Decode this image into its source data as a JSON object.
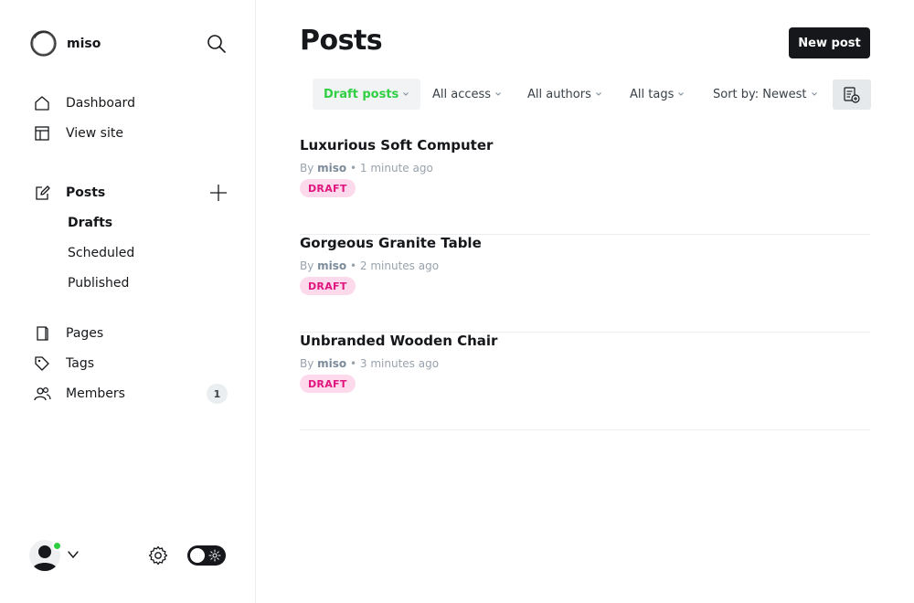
{
  "brand": {
    "name": "miso",
    "logo_icon": "circle-logo-icon"
  },
  "nav": {
    "dashboard": "Dashboard",
    "view_site": "View site",
    "posts": "Posts",
    "drafts": "Drafts",
    "scheduled": "Scheduled",
    "published": "Published",
    "pages": "Pages",
    "tags": "Tags",
    "members": "Members",
    "members_count": "1"
  },
  "header": {
    "title": "Posts",
    "new_post_label": "New post"
  },
  "filters": {
    "type": "Draft posts",
    "access": "All access",
    "authors": "All authors",
    "tags": "All tags",
    "sort": "Sort by: Newest"
  },
  "posts": [
    {
      "title": "Luxurious Soft Computer",
      "by": "By",
      "author": "miso",
      "time": "• 1 minute ago",
      "status": "DRAFT"
    },
    {
      "title": "Gorgeous Granite Table",
      "by": "By",
      "author": "miso",
      "time": "• 2 minutes ago",
      "status": "DRAFT"
    },
    {
      "title": "Unbranded Wooden Chair",
      "by": "By",
      "author": "miso",
      "time": "• 3 minutes ago",
      "status": "DRAFT"
    }
  ],
  "colors": {
    "accent": "#30cf43",
    "draft_bg": "#fdd9ec",
    "draft_text": "#e0157d",
    "dark": "#15171a"
  }
}
